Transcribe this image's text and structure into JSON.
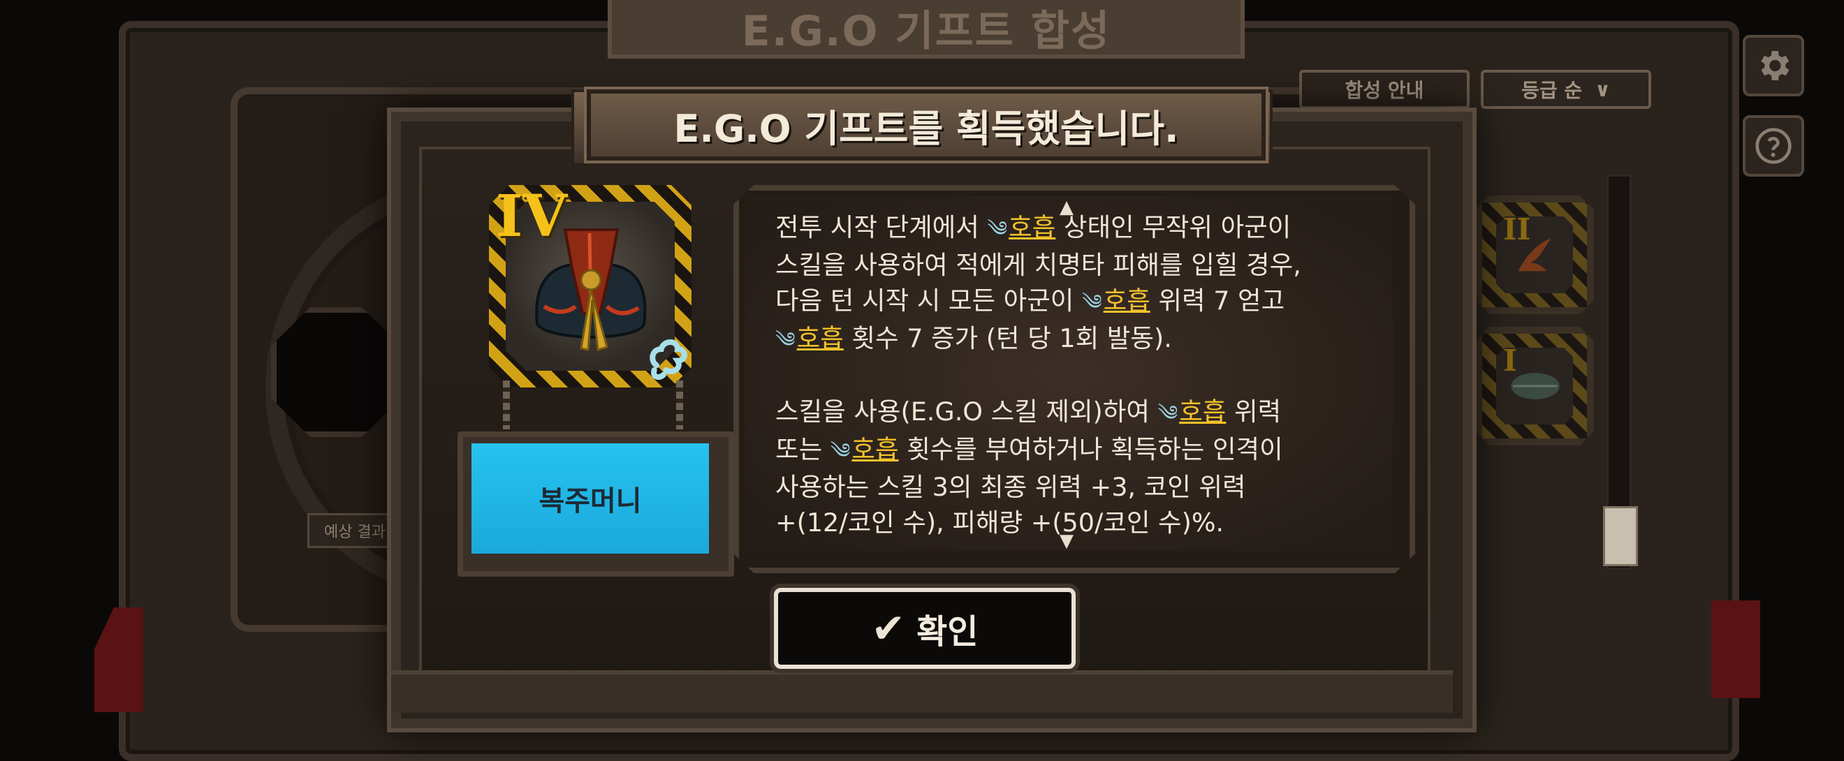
{
  "background": {
    "title": "E.G.O 기프트 합성",
    "synthesis_guide_label": "합성 안내",
    "sort_label": "등급 순",
    "sort_arrow": "∨",
    "expected_result_label": "예상 결과",
    "settings_icon": "gear-icon",
    "help_icon": "question-icon",
    "side_gifts": [
      {
        "grade": "II",
        "icon": "phoenix-feather-icon"
      },
      {
        "grade": "I",
        "icon": "leaf-icon"
      }
    ]
  },
  "modal": {
    "title": "E.G.O 기프트를 획득했습니다.",
    "gift": {
      "grade": "IV",
      "name": "복주머니",
      "icon": "lucky-pouch-icon",
      "keyword_icon": "breath-icon"
    },
    "description": {
      "scroll_up": "▲",
      "scroll_down": "▼",
      "paragraph1": [
        [
          "전투 시작 단계에서 ",
          {
            "kw": "호흡"
          },
          " 상태인 무작위 아군이"
        ],
        [
          "스킬을 사용하여 적에게 치명타 피해를 입힐 경우,"
        ],
        [
          "다음 턴 시작 시 모든 아군이 ",
          {
            "kw": "호흡"
          },
          " 위력 7 얻고"
        ],
        [
          {
            "kw": "호흡"
          },
          " 횟수 7 증가 (턴 당 1회 발동)."
        ]
      ],
      "paragraph2": [
        [
          "스킬을 사용(E.G.O 스킬 제외)하여 ",
          {
            "kw": "호흡"
          },
          " 위력"
        ],
        [
          "또는 ",
          {
            "kw": "호흡"
          },
          " 횟수를 부여하거나 획득하는 인격이"
        ],
        [
          "사용하는 스킬 3의 최종 위력 +3, 코인 위력"
        ],
        [
          "+(12/코인 수), 피해량 +(50/코인 수)%."
        ]
      ]
    },
    "confirm_label": "확인",
    "confirm_icon": "✔"
  },
  "colors": {
    "keyword": "#f3c22b",
    "name_plate": "#27c2ef",
    "grade": "#f5c21a"
  }
}
